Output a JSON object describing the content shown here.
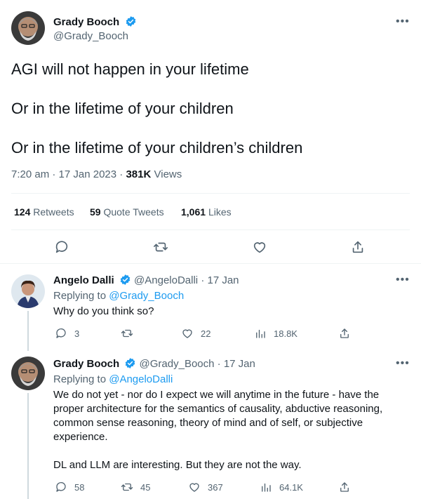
{
  "main_tweet": {
    "author": {
      "name": "Grady Booch",
      "handle": "@Grady_Booch"
    },
    "lines": [
      "AGI will not happen in your lifetime",
      "Or in the lifetime of your children",
      "Or in the lifetime of your children’s children"
    ],
    "time": "7:20 am",
    "date": "17 Jan 2023",
    "views_count": "381K",
    "views_label": "Views",
    "stats": {
      "retweets_count": "124",
      "retweets_label": "Retweets",
      "quotes_count": "59",
      "quotes_label": "Quote Tweets",
      "likes_count": "1,061",
      "likes_label": "Likes"
    }
  },
  "replies": [
    {
      "name": "Angelo Dalli",
      "handle": "@AngeloDalli",
      "date": "17 Jan",
      "replying_prefix": "Replying to",
      "replying_to": "@Grady_Booch",
      "text": "Why do you think so?",
      "replies": "3",
      "retweets": "",
      "likes": "22",
      "views": "18.8K"
    },
    {
      "name": "Grady Booch",
      "handle": "@Grady_Booch",
      "date": "17 Jan",
      "replying_prefix": "Replying to",
      "replying_to": "@AngeloDalli",
      "paragraph1": "We do not yet - nor do I expect we will anytime in the future - have the proper architecture for the semantics of causality, abductive reasoning, common sense reasoning, theory of mind and of self, or subjective experience.",
      "paragraph2": "DL and LLM are interesting. But they are not the way.",
      "replies": "58",
      "retweets": "45",
      "likes": "367",
      "views": "64.1K"
    }
  ],
  "colors": {
    "accent": "#1d9bf0",
    "text": "#0f1419",
    "secondary": "#536471",
    "divider": "#eff3f4"
  },
  "icons": [
    "verified-badge-icon",
    "more-icon",
    "reply-icon",
    "retweet-icon",
    "like-icon",
    "share-icon",
    "views-icon"
  ]
}
